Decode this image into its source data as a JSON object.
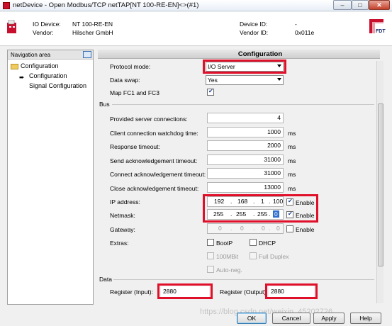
{
  "window": {
    "title": "netDevice - Open Modbus/TCP netTAP[NT 100-RE-EN]<>(#1)",
    "minimize_glyph": "–",
    "maximize_glyph": "□",
    "close_glyph": "✕"
  },
  "header": {
    "io_device_label": "IO Device:",
    "io_device_value": "NT 100-RE-EN",
    "vendor_label": "Vendor:",
    "vendor_value": "Hilscher GmbH",
    "device_id_label": "Device ID:",
    "device_id_value": "-",
    "vendor_id_label": "Vendor ID:",
    "vendor_id_value": "0x011e",
    "fdt_logo_text": "FDT"
  },
  "nav": {
    "title": "Navigation area",
    "root": "Configuration",
    "items": [
      "Configuration",
      "Signal Configuration"
    ]
  },
  "config": {
    "title": "Configuration",
    "protocol_mode_label": "Protocol mode:",
    "protocol_mode_value": "I/O Server",
    "data_swap_label": "Data swap:",
    "data_swap_value": "Yes",
    "map_fc_label": "Map FC1 and FC3",
    "map_fc_checked": true,
    "bus_section": "Bus",
    "fields": [
      {
        "label": "Provided server connections:",
        "value": "4",
        "unit": ""
      },
      {
        "label": "Client connection watchdog time:",
        "value": "1000",
        "unit": "ms"
      },
      {
        "label": "Response timeout:",
        "value": "2000",
        "unit": "ms"
      },
      {
        "label": "Send acknowledgement timeout:",
        "value": "31000",
        "unit": "ms"
      },
      {
        "label": "Connect acknowledgement timeout:",
        "value": "31000",
        "unit": "ms"
      },
      {
        "label": "Close acknowledgement timeout:",
        "value": "13000",
        "unit": "ms"
      }
    ],
    "ip_label": "IP address:",
    "ip": [
      "192",
      "168",
      "1",
      "100"
    ],
    "ip_enable_label": "Enable",
    "netmask_label": "Netmask:",
    "netmask": [
      "255",
      "255",
      "255",
      "0"
    ],
    "netmask_enable_label": "Enable",
    "gateway_label": "Gateway:",
    "gateway": [
      "0",
      "0",
      "0",
      "0"
    ],
    "gateway_enable_label": "Enable",
    "extras_label": "Extras:",
    "bootp_label": "BootP",
    "dhcp_label": "DHCP",
    "mbit_label": "100MBit",
    "full_duplex_label": "Full Duplex",
    "auto_neg_label": "Auto-neg.",
    "data_section": "Data",
    "register_input_label": "Register (Input):",
    "register_input_value": "2880",
    "register_output_label": "Register (Output):",
    "register_output_value": "2880"
  },
  "buttons": {
    "ok": "OK",
    "cancel": "Cancel",
    "apply": "Apply",
    "help": "Help"
  },
  "watermark": "https://blog.csdn.net/weixin_45202726",
  "colors": {
    "highlight": "#e0102a",
    "check": "#1c3f8f"
  }
}
